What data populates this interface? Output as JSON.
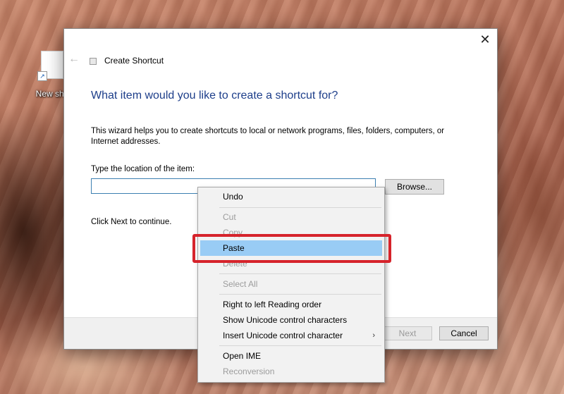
{
  "desktop": {
    "icon_label": "New sho"
  },
  "dialog": {
    "close_glyph": "✕",
    "back_glyph": "←",
    "title": "Create Shortcut",
    "heading": "What item would you like to create a shortcut for?",
    "description": "This wizard helps you to create shortcuts to local or network programs, files, folders, computers, or Internet addresses.",
    "location_label": "Type the location of the item:",
    "location_value": "",
    "browse_label": "Browse...",
    "hint": "Click Next to continue.",
    "next_label": "Next",
    "cancel_label": "Cancel"
  },
  "context_menu": {
    "items": [
      {
        "label": "Undo",
        "enabled": true
      },
      {
        "label": "Cut",
        "enabled": false
      },
      {
        "label": "Copy",
        "enabled": false
      },
      {
        "label": "Paste",
        "enabled": true,
        "highlighted": true
      },
      {
        "label": "Delete",
        "enabled": false
      },
      {
        "label": "Select All",
        "enabled": false
      },
      {
        "label": "Right to left Reading order",
        "enabled": true
      },
      {
        "label": "Show Unicode control characters",
        "enabled": true
      },
      {
        "label": "Insert Unicode control character",
        "enabled": true,
        "submenu": true
      },
      {
        "label": "Open IME",
        "enabled": true
      },
      {
        "label": "Reconversion",
        "enabled": false
      }
    ],
    "submenu_glyph": "›"
  },
  "colors": {
    "highlight": "#99ccf5",
    "annotation": "#d6232b",
    "heading": "#1d3e8a"
  }
}
